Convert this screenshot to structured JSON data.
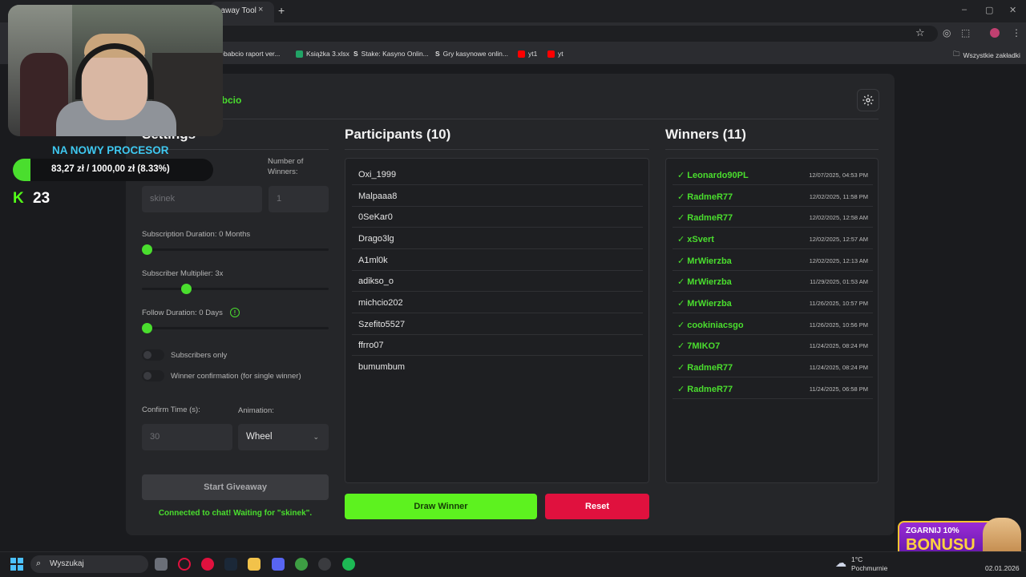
{
  "browser": {
    "tab_title": "eaway Tool",
    "tab_close": "×",
    "new_tab": "+",
    "bookmarks": [
      {
        "label": "kebabcio raport ver...",
        "color": "#3a3a3a"
      },
      {
        "label": "Książka 3.xlsx",
        "color": "#21a366"
      },
      {
        "label": "Stake: Kasyno Onlin...",
        "color": "#ffffff"
      },
      {
        "label": "Gry kasynowe onlin...",
        "color": "#ffffff"
      },
      {
        "label": "yt1",
        "color": "#ff0000"
      },
      {
        "label": "yt",
        "color": "#ff0000"
      }
    ],
    "all_bookmarks": "Wszystkie zakładki"
  },
  "app": {
    "brand": "abcio",
    "settings": {
      "title": "Settings",
      "num_winners_label": "Number of Winners:",
      "keyword_placeholder": "skinek",
      "num_winners_placeholder": "1",
      "sub_duration_label": "Subscription Duration: 0 Months",
      "sub_multiplier_label": "Subscriber Multiplier: 3x",
      "follow_duration_label": "Follow Duration: 0 Days",
      "info_glyph": "!",
      "subscribers_only_label": "Subscribers only",
      "winner_confirm_label": "Winner confirmation (for single winner)",
      "confirm_time_label": "Confirm Time (s):",
      "confirm_time_placeholder": "30",
      "animation_label": "Animation:",
      "animation_value": "Wheel",
      "start_button": "Start Giveaway",
      "status": "Connected to chat! Waiting for \"skinek\".",
      "slider_values": {
        "sub_duration": 0,
        "sub_multiplier": 3,
        "follow_duration": 0
      }
    },
    "participants": {
      "title": "Participants (10)",
      "items": [
        "Oxi_1999",
        "Malpaaa8",
        "0SeKar0",
        "Drago3lg",
        "A1ml0k",
        "adikso_o",
        "michcio202",
        "Szefito5527",
        "ffrro07",
        "bumumbum"
      ]
    },
    "winners": {
      "title": "Winners (11)",
      "items": [
        {
          "name": "✓ Leonardo90PL",
          "date": "12/07/2025, 04:53 PM"
        },
        {
          "name": "✓ RadmeR77",
          "date": "12/02/2025, 11:58 PM"
        },
        {
          "name": "✓ RadmeR77",
          "date": "12/02/2025, 12:58 AM"
        },
        {
          "name": "✓ xSvert",
          "date": "12/02/2025, 12:57 AM"
        },
        {
          "name": "✓ MrWierzba",
          "date": "12/02/2025, 12:13 AM"
        },
        {
          "name": "✓ MrWierzba",
          "date": "11/29/2025, 01:53 AM"
        },
        {
          "name": "✓ MrWierzba",
          "date": "11/26/2025, 10:57 PM"
        },
        {
          "name": "✓ cookiniacsgo",
          "date": "11/26/2025, 10:56 PM"
        },
        {
          "name": "✓ 7MIKO7",
          "date": "11/24/2025, 08:24 PM"
        },
        {
          "name": "✓ RadmeR77",
          "date": "11/24/2025, 08:24 PM"
        },
        {
          "name": "✓ RadmeR77",
          "date": "11/24/2025, 06:58 PM"
        }
      ]
    },
    "draw_button": "Draw Winner",
    "reset_button": "Reset",
    "accent": "#4ade2e",
    "danger": "#e0113e"
  },
  "overlay": {
    "goal_title": "NA NOWY PROCESOR",
    "goal_text": "83,27 zł / 1000,00 zł (8.33%)",
    "goal_progress": 0.0833,
    "kick_logo": "K",
    "kick_count": "23",
    "promo_small": "ZGARNIJ 10%",
    "promo_big": "BONUSU"
  },
  "taskbar": {
    "search_placeholder": "Wyszukaj",
    "weather_temp": "1°C",
    "weather_desc": "Pochmurnie",
    "date": "02.01.2026"
  }
}
